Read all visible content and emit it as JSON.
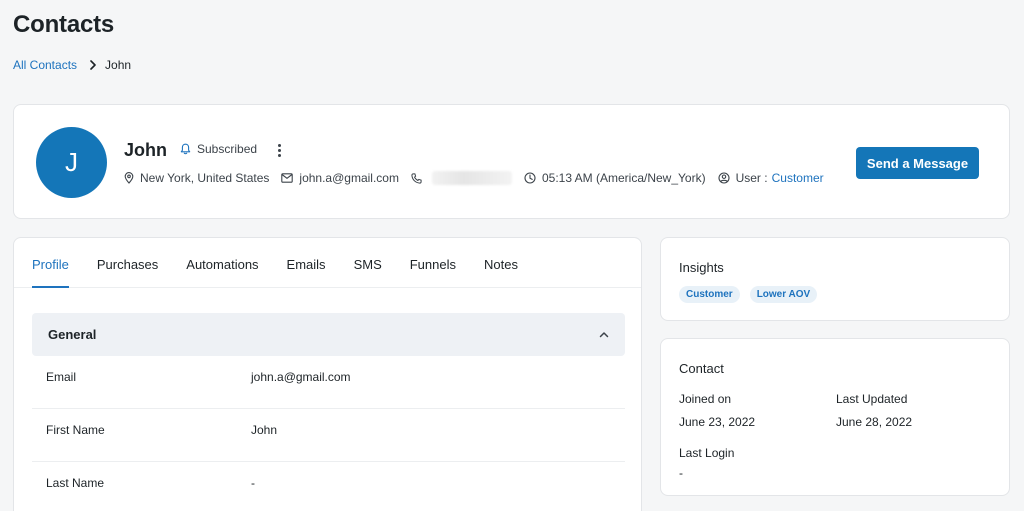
{
  "page": {
    "title": "Contacts"
  },
  "breadcrumb": {
    "parent": "All Contacts",
    "current": "John"
  },
  "contact": {
    "initial": "J",
    "name": "John",
    "status": "Subscribed",
    "location": "New York, United States",
    "email": "john.a@gmail.com",
    "time": "05:13 AM (America/New_York)",
    "user_label": "User :",
    "user_role": "Customer"
  },
  "actions": {
    "send_message": "Send a Message"
  },
  "tabs": [
    {
      "label": "Profile",
      "active": true
    },
    {
      "label": "Purchases"
    },
    {
      "label": "Automations"
    },
    {
      "label": "Emails"
    },
    {
      "label": "SMS"
    },
    {
      "label": "Funnels"
    },
    {
      "label": "Notes"
    }
  ],
  "general": {
    "title": "General",
    "fields": [
      {
        "label": "Email",
        "value": "john.a@gmail.com"
      },
      {
        "label": "First Name",
        "value": "John"
      },
      {
        "label": "Last Name",
        "value": "-"
      }
    ]
  },
  "insights": {
    "title": "Insights",
    "tags": [
      "Customer",
      "Lower AOV"
    ]
  },
  "contact_info": {
    "title": "Contact",
    "joined_label": "Joined on",
    "joined_value": "June 23, 2022",
    "updated_label": "Last Updated",
    "updated_value": "June 28, 2022",
    "login_label": "Last Login",
    "login_value": "-"
  },
  "colors": {
    "accent": "#1476b8",
    "link": "#1e73be"
  }
}
